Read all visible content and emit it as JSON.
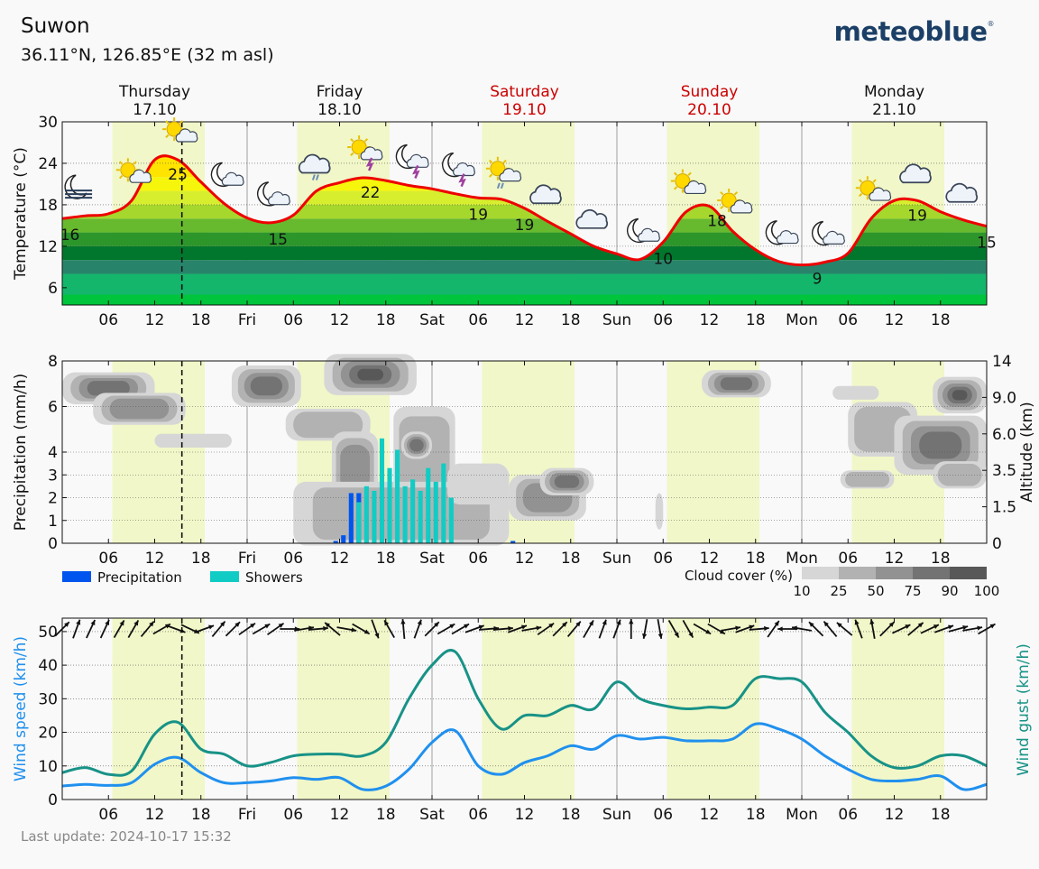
{
  "header": {
    "location": "Suwon",
    "coordinates": "36.11°N, 126.85°E (32 m asl)",
    "logo": "meteoblue",
    "logo_mark": "®"
  },
  "footer": {
    "last_update": "Last update: 2024-10-17 15:32"
  },
  "colors": {
    "weekend": "#cc0000",
    "temperature_line": "#ee0000",
    "daylight": "#f1f7c8",
    "precip": "#0055ee",
    "showers": "#11ccc4",
    "wind_speed": "#2090ee",
    "wind_gust": "#189287"
  },
  "days": [
    {
      "name": "Thursday",
      "date": "17.10",
      "weekend": false
    },
    {
      "name": "Friday",
      "date": "18.10",
      "weekend": false
    },
    {
      "name": "Saturday",
      "date": "19.10",
      "weekend": true
    },
    {
      "name": "Sunday",
      "date": "20.10",
      "weekend": true
    },
    {
      "name": "Monday",
      "date": "21.10",
      "weekend": false
    }
  ],
  "time_axis": {
    "start": "2024-10-17 00:00",
    "end": "2024-10-22 00:00",
    "tick_labels": [
      "06",
      "12",
      "18",
      "Fri",
      "06",
      "12",
      "18",
      "Sat",
      "06",
      "12",
      "18",
      "Sun",
      "06",
      "12",
      "18",
      "Mon",
      "06",
      "12",
      "18"
    ],
    "current_time": "2024-10-17 15:32"
  },
  "daylight_hours": [
    6.5,
    18.5
  ],
  "chart_data": [
    {
      "type": "line",
      "id": "temperature",
      "ylabel": "Temperature (°C)",
      "ylim": [
        3.5,
        30
      ],
      "yticks": [
        "6",
        "12",
        "18",
        "24",
        "30"
      ],
      "grid": true,
      "band_colors": [
        "#00c43b",
        "#13b66b",
        "#27846a",
        "#00772c",
        "#2c962b",
        "#67b92e",
        "#a6d72d",
        "#d6ee2d",
        "#f6f50c",
        "#ffe400"
      ],
      "band_breaks": [
        3.5,
        5,
        8,
        10,
        12,
        14,
        16,
        18,
        20,
        22,
        24
      ],
      "x_hours": [
        0,
        3,
        6,
        9,
        12,
        15,
        18,
        21,
        24,
        27,
        30,
        33,
        36,
        39,
        42,
        45,
        48,
        51,
        54,
        57,
        60,
        63,
        66,
        69,
        72,
        75,
        78,
        81,
        84,
        87,
        90,
        93,
        96,
        99,
        102,
        105,
        108,
        111,
        114,
        117,
        120
      ],
      "values": [
        16.0,
        16.4,
        16.7,
        18.6,
        24.5,
        24.5,
        21.3,
        18.2,
        16.1,
        15.4,
        16.5,
        20.0,
        21.2,
        21.9,
        21.5,
        20.8,
        20.3,
        19.6,
        19.0,
        18.8,
        17.5,
        15.6,
        13.8,
        12.0,
        10.9,
        10.1,
        12.6,
        17.0,
        17.8,
        14.2,
        11.5,
        9.8,
        9.3,
        9.7,
        11.0,
        16.0,
        18.6,
        18.6,
        17.0,
        15.8,
        14.9
      ],
      "labels": [
        {
          "hour": 1,
          "text": "16"
        },
        {
          "hour": 15,
          "text": "25"
        },
        {
          "hour": 28,
          "text": "15"
        },
        {
          "hour": 40,
          "text": "22"
        },
        {
          "hour": 54,
          "text": "19"
        },
        {
          "hour": 60,
          "text": "19"
        },
        {
          "hour": 78,
          "text": "10"
        },
        {
          "hour": 85,
          "text": "18"
        },
        {
          "hour": 98,
          "text": "9"
        },
        {
          "hour": 111,
          "text": "19"
        },
        {
          "hour": 120,
          "text": "15"
        }
      ],
      "weather_icons": [
        {
          "hour": 2,
          "kind": "moon-fog"
        },
        {
          "hour": 9,
          "kind": "sun-cloud"
        },
        {
          "hour": 15,
          "kind": "sun-cloud"
        },
        {
          "hour": 21,
          "kind": "moon-cloud"
        },
        {
          "hour": 27,
          "kind": "moon-cloud"
        },
        {
          "hour": 33,
          "kind": "cloud-rain"
        },
        {
          "hour": 39,
          "kind": "sun-storm"
        },
        {
          "hour": 45,
          "kind": "moon-storm"
        },
        {
          "hour": 51,
          "kind": "moon-storm"
        },
        {
          "hour": 57,
          "kind": "sun-rain"
        },
        {
          "hour": 63,
          "kind": "cloud"
        },
        {
          "hour": 69,
          "kind": "cloud"
        },
        {
          "hour": 75,
          "kind": "moon-cloud"
        },
        {
          "hour": 81,
          "kind": "sun-cloud"
        },
        {
          "hour": 87,
          "kind": "sun-cloud"
        },
        {
          "hour": 93,
          "kind": "moon-cloud"
        },
        {
          "hour": 99,
          "kind": "moon-cloud"
        },
        {
          "hour": 105,
          "kind": "sun-cloud"
        },
        {
          "hour": 111,
          "kind": "cloud"
        },
        {
          "hour": 117,
          "kind": "cloud"
        }
      ]
    },
    {
      "type": "bar",
      "id": "precipitation",
      "ylabel": "Precipitation (mm/h)",
      "ylabel_right": "Altitude (km)",
      "ylim": [
        0,
        8
      ],
      "yticks": [
        "0",
        "1",
        "2",
        "3",
        "4",
        "6",
        "8"
      ],
      "yticks_right": [
        "0",
        "1.5",
        "3.5",
        "6.0",
        "9.0",
        "14"
      ],
      "series": [
        {
          "name": "Precipitation",
          "x_hours": [
            35,
            36,
            37,
            38,
            58
          ],
          "values": [
            0.1,
            0.35,
            2.2,
            2.2,
            0.1
          ]
        },
        {
          "name": "Showers",
          "x_hours": [
            38,
            39,
            40,
            41,
            42,
            43,
            44,
            45,
            46,
            47,
            48,
            49,
            50
          ],
          "values": [
            1.8,
            2.5,
            2.3,
            4.6,
            3.3,
            4.1,
            2.5,
            2.8,
            2.3,
            3.3,
            2.7,
            3.5,
            2.0
          ]
        }
      ],
      "cloud_legend_title": "Cloud cover (%)",
      "cloud_legend_levels": [
        "10",
        "25",
        "50",
        "75",
        "90",
        "100"
      ],
      "cloud_colors": [
        "#d6d6d6",
        "#b2b2b2",
        "#929292",
        "#737373",
        "#585858"
      ],
      "cloud_layers": [
        {
          "h0": 0,
          "h1": 12,
          "alt": 6.8,
          "thick": 0.7,
          "cover": 4
        },
        {
          "h0": 4,
          "h1": 16,
          "alt": 5.9,
          "thick": 0.7,
          "cover": 3
        },
        {
          "h0": 12,
          "h1": 22,
          "alt": 4.5,
          "thick": 0.3,
          "cover": 1
        },
        {
          "h0": 22,
          "h1": 31,
          "alt": 6.9,
          "thick": 0.9,
          "cover": 4
        },
        {
          "h0": 34,
          "h1": 46,
          "alt": 7.4,
          "thick": 0.9,
          "cover": 5
        },
        {
          "h0": 29,
          "h1": 40,
          "alt": 5.2,
          "thick": 0.7,
          "cover": 2
        },
        {
          "h0": 35,
          "h1": 41,
          "alt": 3.3,
          "thick": 1.6,
          "cover": 3
        },
        {
          "h0": 43,
          "h1": 51,
          "alt": 3.6,
          "thick": 2.4,
          "cover": 2
        },
        {
          "h0": 44,
          "h1": 48,
          "alt": 4.3,
          "thick": 0.6,
          "cover": 4
        },
        {
          "h0": 30,
          "h1": 58,
          "alt": 1.3,
          "thick": 1.4,
          "cover": 2
        },
        {
          "h0": 50,
          "h1": 58,
          "alt": 2.6,
          "thick": 0.9,
          "cover": 1
        },
        {
          "h0": 58,
          "h1": 68,
          "alt": 2.0,
          "thick": 1.0,
          "cover": 3
        },
        {
          "h0": 62,
          "h1": 69,
          "alt": 2.7,
          "thick": 0.6,
          "cover": 4
        },
        {
          "h0": 83,
          "h1": 92,
          "alt": 7.0,
          "thick": 0.6,
          "cover": 4
        },
        {
          "h0": 100,
          "h1": 106,
          "alt": 6.6,
          "thick": 0.3,
          "cover": 1
        },
        {
          "h0": 102,
          "h1": 111,
          "alt": 5.0,
          "thick": 1.2,
          "cover": 2
        },
        {
          "h0": 108,
          "h1": 120,
          "alt": 4.3,
          "thick": 1.3,
          "cover": 4
        },
        {
          "h0": 113,
          "h1": 120,
          "alt": 6.5,
          "thick": 0.8,
          "cover": 5
        },
        {
          "h0": 101,
          "h1": 108,
          "alt": 2.8,
          "thick": 0.4,
          "cover": 2
        },
        {
          "h0": 113,
          "h1": 120,
          "alt": 3.0,
          "thick": 0.6,
          "cover": 2
        },
        {
          "h0": 77,
          "h1": 78,
          "alt": 1.4,
          "thick": 0.8,
          "cover": 1
        }
      ]
    },
    {
      "type": "line",
      "id": "wind",
      "ylabel": "Wind speed (km/h)",
      "ylabel_right": "Wind gust (km/h)",
      "ylim": [
        0,
        54
      ],
      "yticks": [
        "0",
        "10",
        "20",
        "30",
        "40",
        "50"
      ],
      "x_hours": [
        0,
        3,
        6,
        9,
        12,
        15,
        18,
        21,
        24,
        27,
        30,
        33,
        36,
        39,
        42,
        45,
        48,
        51,
        54,
        57,
        60,
        63,
        66,
        69,
        72,
        75,
        78,
        81,
        84,
        87,
        90,
        93,
        96,
        99,
        102,
        105,
        108,
        111,
        114,
        117,
        120
      ],
      "series": [
        {
          "name": "Wind speed",
          "values": [
            4,
            4.5,
            4.2,
            5,
            10.5,
            12.5,
            8,
            5,
            5,
            5.5,
            6.5,
            6,
            6.5,
            3,
            4,
            9,
            17,
            20.5,
            10,
            7.5,
            11,
            13,
            16,
            15,
            19,
            18,
            18.5,
            17.5,
            17.5,
            18,
            22.5,
            21,
            18,
            13,
            9,
            6,
            5.5,
            6,
            7,
            3,
            4.5
          ]
        },
        {
          "name": "Wind gust",
          "values": [
            8,
            9.5,
            7.5,
            8.5,
            19.5,
            23,
            15,
            13.5,
            10,
            11,
            13,
            13.5,
            13.5,
            13,
            17,
            30,
            40,
            44,
            30,
            21,
            25,
            25,
            28,
            27,
            35,
            30,
            28,
            27,
            27.5,
            28,
            36,
            36,
            35,
            26,
            20,
            13,
            9.5,
            10,
            13,
            13,
            10
          ]
        }
      ],
      "wind_dirs_deg": [
        225,
        200,
        205,
        205,
        210,
        210,
        220,
        240,
        290,
        295,
        250,
        220,
        225,
        235,
        240,
        235,
        270,
        260,
        265,
        130,
        280,
        300,
        340,
        150,
        175,
        200,
        225,
        240,
        240,
        250,
        265,
        265,
        250,
        260,
        235,
        225,
        220,
        210,
        200,
        200,
        180,
        10,
        350,
        330,
        330,
        300,
        300,
        260,
        250,
        265,
        215,
        90,
        100,
        135,
        140,
        130,
        160,
        170,
        225,
        245,
        230,
        245,
        250,
        255,
        260,
        240
      ]
    }
  ]
}
